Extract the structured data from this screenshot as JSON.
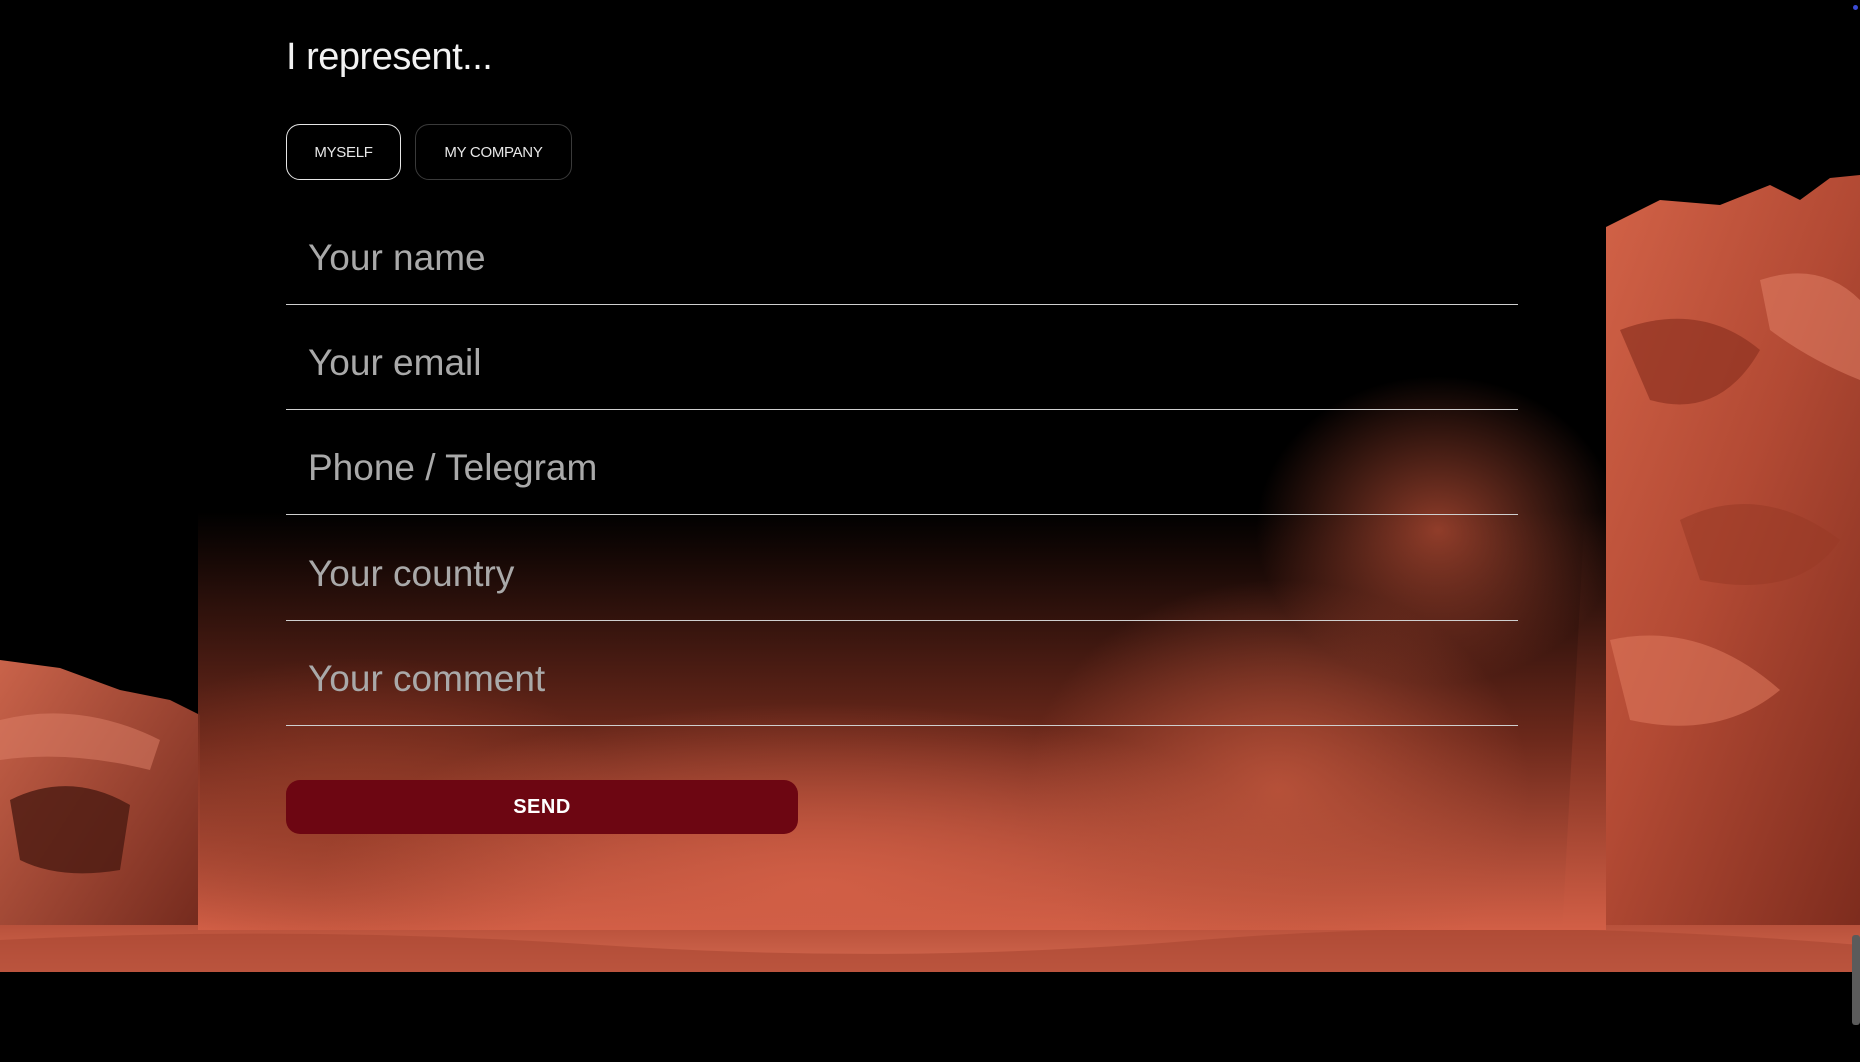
{
  "heading": "I represent...",
  "represent_options": [
    {
      "label": "MYSELF",
      "selected": true
    },
    {
      "label": "MY COMPANY",
      "selected": false
    }
  ],
  "form": {
    "name": {
      "placeholder": "Your name",
      "value": ""
    },
    "email": {
      "placeholder": "Your email",
      "value": ""
    },
    "phone": {
      "placeholder": "Phone / Telegram",
      "value": ""
    },
    "country": {
      "placeholder": "Your country",
      "value": ""
    },
    "comment": {
      "placeholder": "Your comment",
      "value": ""
    }
  },
  "send_label": "SEND",
  "colors": {
    "background": "#000000",
    "accent": "#6d0612",
    "rock": "#c8573f"
  }
}
